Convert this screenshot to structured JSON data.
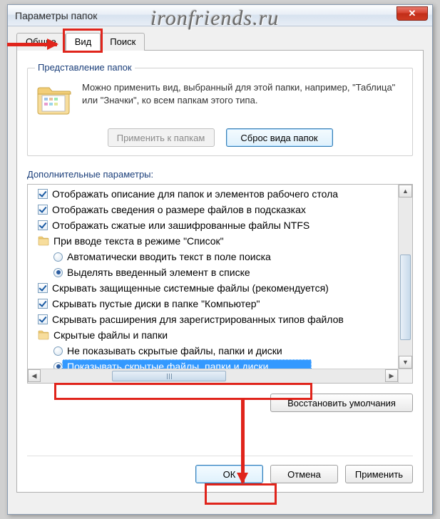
{
  "watermark": "ironfriends.ru",
  "window": {
    "title": "Параметры папок"
  },
  "close_glyph": "✕",
  "tabs": {
    "general": "Общие",
    "view": "Вид",
    "search": "Поиск"
  },
  "folder_views": {
    "legend": "Представление папок",
    "description": "Можно применить вид, выбранный для этой папки, например, \"Таблица\" или \"Значки\", ко всем папкам этого типа.",
    "apply_btn": "Применить к папкам",
    "reset_btn": "Сброс вида папок"
  },
  "advanced": {
    "label": "Дополнительные параметры:",
    "items": [
      {
        "kind": "check",
        "indent": 0,
        "checked": true,
        "label": "Отображать описание для папок и элементов рабочего стола"
      },
      {
        "kind": "check",
        "indent": 0,
        "checked": true,
        "label": "Отображать сведения о размере файлов в подсказках"
      },
      {
        "kind": "check",
        "indent": 0,
        "checked": true,
        "label": "Отображать сжатые или зашифрованные файлы NTFS"
      },
      {
        "kind": "group",
        "indent": 0,
        "label": "При вводе текста в режиме \"Список\""
      },
      {
        "kind": "radio",
        "indent": 1,
        "checked": false,
        "label": "Автоматически вводить текст в поле поиска"
      },
      {
        "kind": "radio",
        "indent": 1,
        "checked": true,
        "label": "Выделять введенный элемент в списке"
      },
      {
        "kind": "check",
        "indent": 0,
        "checked": true,
        "label": "Скрывать защищенные системные файлы (рекомендуется)"
      },
      {
        "kind": "check",
        "indent": 0,
        "checked": true,
        "label": "Скрывать пустые диски в папке \"Компьютер\""
      },
      {
        "kind": "check",
        "indent": 0,
        "checked": true,
        "label": "Скрывать расширения для зарегистрированных типов файлов"
      },
      {
        "kind": "group",
        "indent": 0,
        "label": "Скрытые файлы и папки"
      },
      {
        "kind": "radio",
        "indent": 1,
        "checked": false,
        "label": "Не показывать скрытые файлы, папки и диски"
      },
      {
        "kind": "radio",
        "indent": 1,
        "checked": true,
        "label": "Показывать скрытые файлы, папки и диски",
        "highlighted": true
      }
    ],
    "restore_btn": "Восстановить умолчания"
  },
  "dialog_buttons": {
    "ok": "ОК",
    "cancel": "Отмена",
    "apply": "Применить"
  }
}
